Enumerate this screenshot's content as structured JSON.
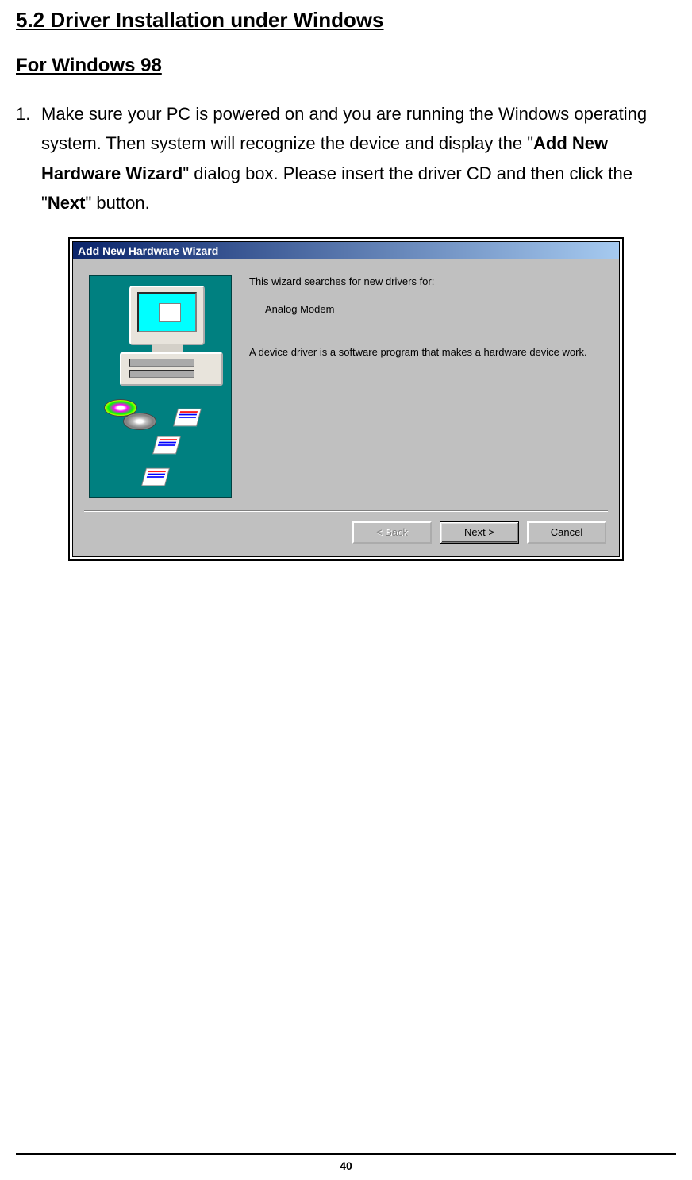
{
  "heading": "5.2 Driver Installation under Windows",
  "sub_heading": "For Windows 98",
  "instruction": {
    "number": "1.",
    "parts": {
      "p1": "Make sure your PC is powered on and you are running the Windows operating system. Then system will recognize the device and display the \"",
      "bold1": "Add New Hardware Wizard",
      "p2": "\" dialog box. Please insert the driver CD and then click the \"",
      "bold2": "Next",
      "p3": "\" button."
    }
  },
  "dialog": {
    "title": "Add New Hardware Wizard",
    "line1": "This wizard searches for new drivers for:",
    "device": "Analog Modem",
    "line2": "A device driver is a software program that makes a hardware device work.",
    "buttons": {
      "back": "< Back",
      "next": "Next >",
      "cancel": "Cancel"
    }
  },
  "page_number": "40"
}
